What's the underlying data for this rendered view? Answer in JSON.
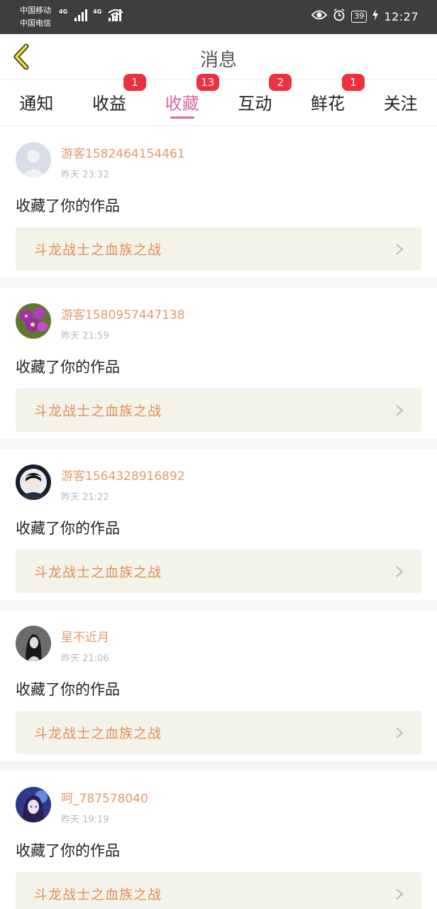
{
  "status_bar": {
    "carrier_1": "中国移动",
    "carrier_2": "中国电信",
    "network_1": "4G",
    "network_2": "4G",
    "battery": "39",
    "time": "12:27"
  },
  "header": {
    "title": "消息"
  },
  "tabs": [
    {
      "label": "通知",
      "badge": ""
    },
    {
      "label": "收益",
      "badge": "1"
    },
    {
      "label": "收藏",
      "badge": "13",
      "active": true
    },
    {
      "label": "互动",
      "badge": "2"
    },
    {
      "label": "鲜花",
      "badge": "1"
    },
    {
      "label": "关注",
      "badge": ""
    }
  ],
  "items": [
    {
      "user": "游客1582464154461",
      "time": "昨天 23:32",
      "message": "收藏了你的作品",
      "work": "斗龙战士之血族之战",
      "avatar": "default-avatar"
    },
    {
      "user": "游客1580957447138",
      "time": "昨天 21:59",
      "message": "收藏了你的作品",
      "work": "斗龙战士之血族之战",
      "avatar": "flower-avatar"
    },
    {
      "user": "游客1564328916892",
      "time": "昨天 21:22",
      "message": "收藏了你的作品",
      "work": "斗龙战士之血族之战",
      "avatar": "anime-avatar"
    },
    {
      "user": "星不近月",
      "time": "昨天 21:06",
      "message": "收藏了你的作品",
      "work": "斗龙战士之血族之战",
      "avatar": "photo-avatar"
    },
    {
      "user": "呵_787578040",
      "time": "昨天 19:19",
      "message": "收藏了你的作品",
      "work": "斗龙战士之血族之战",
      "avatar": "anime-girl-avatar"
    }
  ],
  "colors": {
    "accent": "#d76aa7",
    "username": "#e29a6a",
    "work_title": "#e48c55",
    "badge": "#f0303e"
  }
}
